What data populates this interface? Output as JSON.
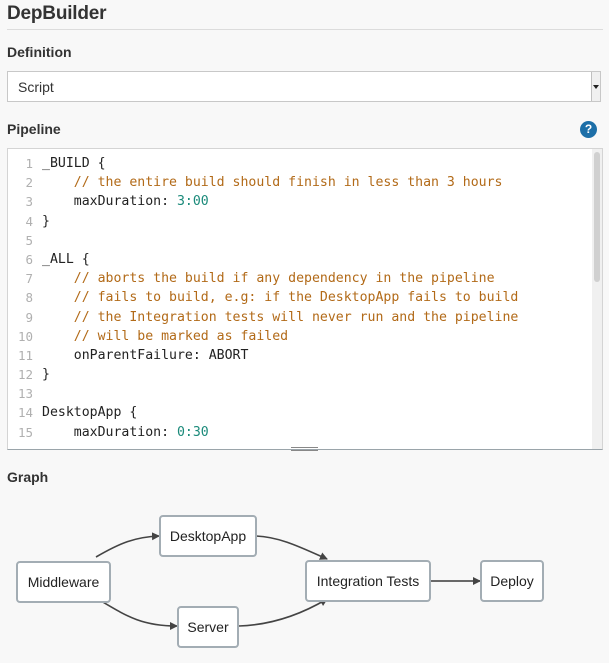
{
  "header": {
    "title": "DepBuilder"
  },
  "definition": {
    "label": "Definition",
    "selected": "Script"
  },
  "pipeline": {
    "label": "Pipeline",
    "help_icon": "?",
    "lines": [
      {
        "n": "1",
        "parts": [
          {
            "t": "tx",
            "v": "_BUILD {"
          }
        ]
      },
      {
        "n": "2",
        "parts": [
          {
            "t": "cm",
            "v": "    // the entire build should finish in less than 3 hours"
          }
        ]
      },
      {
        "n": "3",
        "parts": [
          {
            "t": "tx",
            "v": "    maxDuration: "
          },
          {
            "t": "nm",
            "v": "3:00"
          }
        ]
      },
      {
        "n": "4",
        "parts": [
          {
            "t": "tx",
            "v": "}"
          }
        ]
      },
      {
        "n": "5",
        "parts": [
          {
            "t": "tx",
            "v": ""
          }
        ]
      },
      {
        "n": "6",
        "parts": [
          {
            "t": "tx",
            "v": "_ALL {"
          }
        ]
      },
      {
        "n": "7",
        "parts": [
          {
            "t": "cm",
            "v": "    // aborts the build if any dependency in the pipeline"
          }
        ]
      },
      {
        "n": "8",
        "parts": [
          {
            "t": "cm",
            "v": "    // fails to build, e.g: if the DesktopApp fails to build"
          }
        ]
      },
      {
        "n": "9",
        "parts": [
          {
            "t": "cm",
            "v": "    // the Integration tests will never run and the pipeline"
          }
        ]
      },
      {
        "n": "10",
        "parts": [
          {
            "t": "cm",
            "v": "    // will be marked as failed"
          }
        ]
      },
      {
        "n": "11",
        "parts": [
          {
            "t": "tx",
            "v": "    onParentFailure: ABORT"
          }
        ]
      },
      {
        "n": "12",
        "parts": [
          {
            "t": "tx",
            "v": "}"
          }
        ]
      },
      {
        "n": "13",
        "parts": [
          {
            "t": "tx",
            "v": ""
          }
        ]
      },
      {
        "n": "14",
        "parts": [
          {
            "t": "tx",
            "v": "DesktopApp {"
          }
        ]
      },
      {
        "n": "15",
        "parts": [
          {
            "t": "tx",
            "v": "    maxDuration: "
          },
          {
            "t": "nm",
            "v": "0:30"
          }
        ]
      }
    ]
  },
  "graph": {
    "label": "Graph",
    "nodes": [
      {
        "id": "middleware",
        "label": "Middleware"
      },
      {
        "id": "desktopapp",
        "label": "DesktopApp"
      },
      {
        "id": "server",
        "label": "Server"
      },
      {
        "id": "integration",
        "label": "Integration Tests"
      },
      {
        "id": "deploy",
        "label": "Deploy"
      }
    ],
    "edges": [
      {
        "from": "middleware",
        "to": "desktopapp"
      },
      {
        "from": "middleware",
        "to": "server"
      },
      {
        "from": "desktopapp",
        "to": "integration"
      },
      {
        "from": "server",
        "to": "integration"
      },
      {
        "from": "integration",
        "to": "deploy"
      }
    ]
  },
  "colors": {
    "comment": "#b26a18",
    "number": "#1b8a7a",
    "help": "#1d6fa8",
    "node_border": "#a3adb4",
    "edge": "#444444"
  }
}
